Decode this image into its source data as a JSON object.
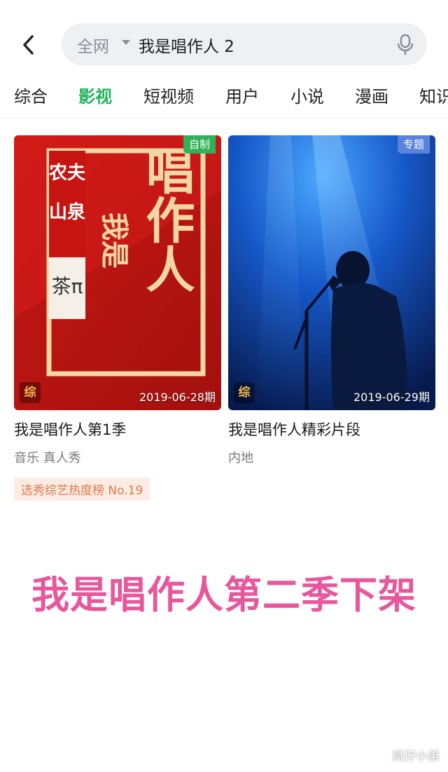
{
  "header": {
    "scope_label": "全网",
    "query": "我是唱作人 2"
  },
  "tabs": [
    {
      "label": "综合"
    },
    {
      "label": "影视"
    },
    {
      "label": "短视频"
    },
    {
      "label": "用户"
    },
    {
      "label": "小说"
    },
    {
      "label": "漫画"
    },
    {
      "label": "知识"
    }
  ],
  "active_tab": "影视",
  "results": [
    {
      "badge": "自制",
      "badge_color": "#2fb25a",
      "type_tag": "综",
      "date": "2019-06-28期",
      "title": "我是唱作人第1季",
      "meta": "音乐 真人秀",
      "rank": "选秀综艺热度榜 No.19",
      "poster_text": {
        "sponsor_lines": [
          "农夫",
          "山泉"
        ],
        "product": "茶π",
        "logo_title": "唱作人",
        "logo_sub": "我是"
      }
    },
    {
      "badge": "专题",
      "badge_color": "#5a82d8",
      "type_tag": "综",
      "date": "2019-06-29期",
      "title": "我是唱作人精彩片段",
      "meta": "内地"
    }
  ],
  "caption": "我是唱作人第二季下架",
  "watermark": "岚仔小弟",
  "colors": {
    "accent": "#1fb45a",
    "caption": "#e8579c",
    "rank_text": "#e0784a"
  }
}
